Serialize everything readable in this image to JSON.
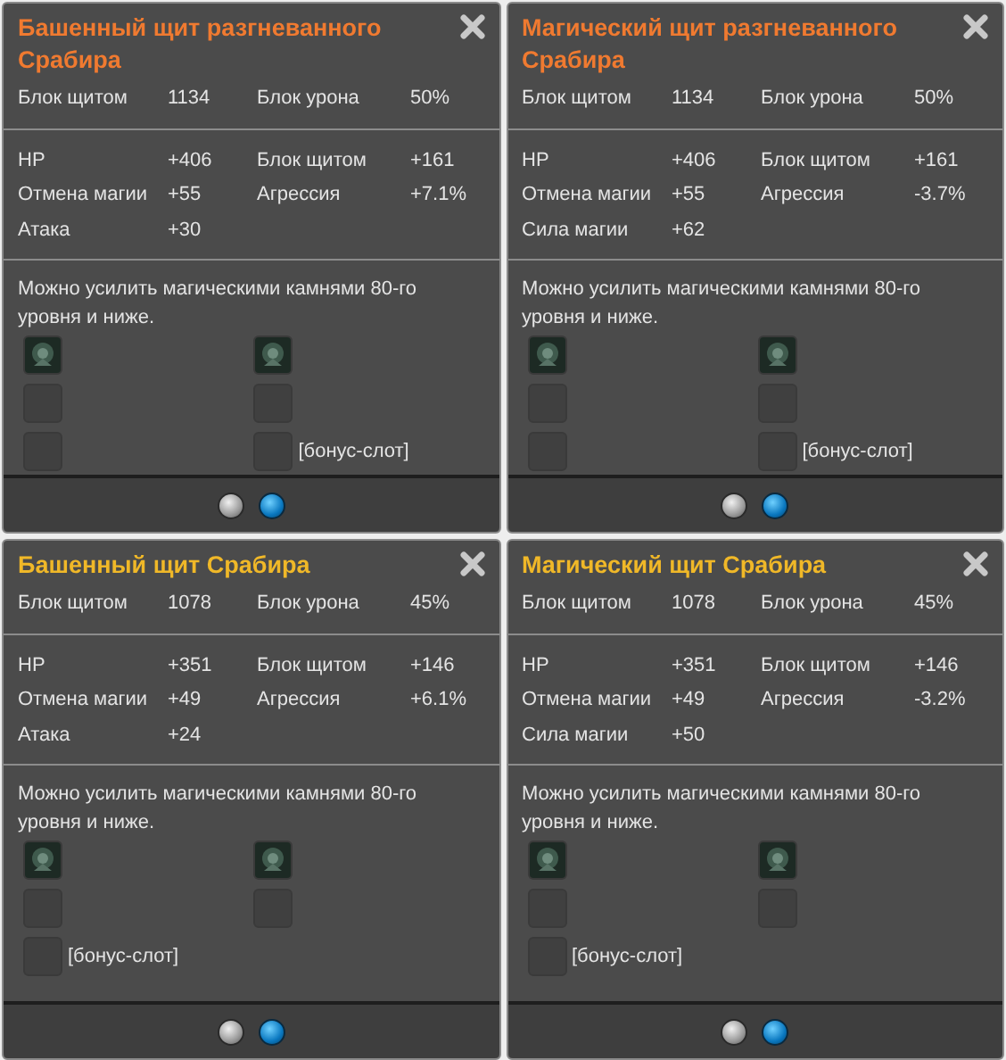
{
  "panels": [
    {
      "title": "Башенный щит разгневанного Срабира",
      "color": "#f07a30",
      "base": [
        {
          "label": "Блок щитом",
          "value": "1134"
        },
        {
          "label": "Блок урона",
          "value": "50%"
        }
      ],
      "bonus": [
        {
          "label": "HP",
          "value": "+406"
        },
        {
          "label": "Блок щитом",
          "value": "+161"
        },
        {
          "label": "Отмена магии",
          "value": "+55"
        },
        {
          "label": "Агрессия",
          "value": "+7.1%"
        },
        {
          "label": "Атака",
          "value": "+30"
        }
      ],
      "note": "Можно усилить магическими камнями 80-го уровня и ниже.",
      "sockets": [
        {
          "filled": true
        },
        {
          "filled": true
        },
        {
          "filled": false
        },
        {
          "filled": false
        },
        {
          "filled": false
        },
        {
          "filled": false,
          "label": "[бонус-слот]"
        }
      ],
      "pages": [
        {
          "selected": false
        },
        {
          "selected": true
        }
      ]
    },
    {
      "title": "Магический щит разгневанного Срабира",
      "color": "#f07a30",
      "base": [
        {
          "label": "Блок щитом",
          "value": "1134"
        },
        {
          "label": "Блок урона",
          "value": "50%"
        }
      ],
      "bonus": [
        {
          "label": "HP",
          "value": "+406"
        },
        {
          "label": "Блок щитом",
          "value": "+161"
        },
        {
          "label": "Отмена магии",
          "value": "+55"
        },
        {
          "label": "Агрессия",
          "value": "-3.7%"
        },
        {
          "label": "Сила магии",
          "value": "+62"
        }
      ],
      "note": "Можно усилить магическими камнями 80-го уровня и ниже.",
      "sockets": [
        {
          "filled": true
        },
        {
          "filled": true
        },
        {
          "filled": false
        },
        {
          "filled": false
        },
        {
          "filled": false
        },
        {
          "filled": false,
          "label": "[бонус-слот]"
        }
      ],
      "pages": [
        {
          "selected": false
        },
        {
          "selected": true
        }
      ]
    },
    {
      "title": "Башенный щит Срабира",
      "color": "#f0b828",
      "base": [
        {
          "label": "Блок щитом",
          "value": "1078"
        },
        {
          "label": "Блок урона",
          "value": "45%"
        }
      ],
      "bonus": [
        {
          "label": "HP",
          "value": "+351"
        },
        {
          "label": "Блок щитом",
          "value": "+146"
        },
        {
          "label": "Отмена магии",
          "value": "+49"
        },
        {
          "label": "Агрессия",
          "value": "+6.1%"
        },
        {
          "label": "Атака",
          "value": "+24"
        }
      ],
      "note": "Можно усилить магическими камнями 80-го уровня и ниже.",
      "sockets": [
        {
          "filled": true
        },
        {
          "filled": true
        },
        {
          "filled": false
        },
        {
          "filled": false
        },
        {
          "filled": false,
          "label": "[бонус-слот]"
        }
      ],
      "pages": [
        {
          "selected": false
        },
        {
          "selected": true
        }
      ]
    },
    {
      "title": "Магический щит Срабира",
      "color": "#f0b828",
      "base": [
        {
          "label": "Блок щитом",
          "value": "1078"
        },
        {
          "label": "Блок урона",
          "value": "45%"
        }
      ],
      "bonus": [
        {
          "label": "HP",
          "value": "+351"
        },
        {
          "label": "Блок щитом",
          "value": "+146"
        },
        {
          "label": "Отмена магии",
          "value": "+49"
        },
        {
          "label": "Агрессия",
          "value": "-3.2%"
        },
        {
          "label": "Сила магии",
          "value": "+50"
        }
      ],
      "note": "Можно усилить магическими камнями 80-го уровня и ниже.",
      "sockets": [
        {
          "filled": true
        },
        {
          "filled": true
        },
        {
          "filled": false
        },
        {
          "filled": false
        },
        {
          "filled": false,
          "label": "[бонус-слот]"
        }
      ],
      "pages": [
        {
          "selected": false
        },
        {
          "selected": true
        }
      ]
    }
  ]
}
